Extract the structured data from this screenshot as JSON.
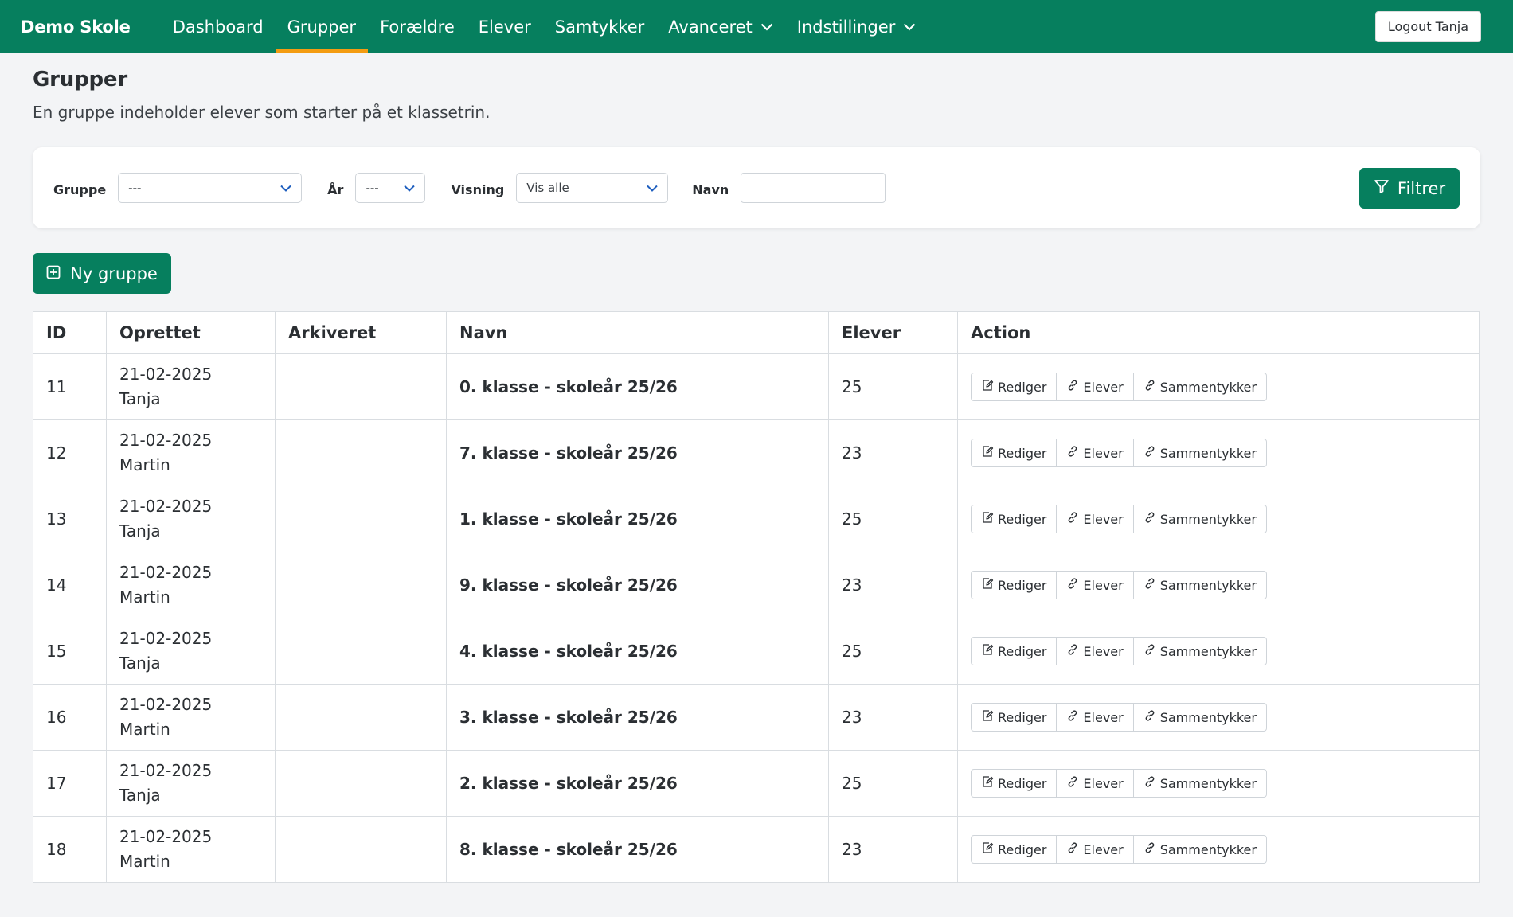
{
  "navbar": {
    "brand": "Demo Skole",
    "items": [
      {
        "label": "Dashboard",
        "active": false,
        "dropdown": false
      },
      {
        "label": "Grupper",
        "active": true,
        "dropdown": false
      },
      {
        "label": "Forældre",
        "active": false,
        "dropdown": false
      },
      {
        "label": "Elever",
        "active": false,
        "dropdown": false
      },
      {
        "label": "Samtykker",
        "active": false,
        "dropdown": false
      },
      {
        "label": "Avanceret",
        "active": false,
        "dropdown": true
      },
      {
        "label": "Indstillinger",
        "active": false,
        "dropdown": true
      }
    ],
    "logout_label": "Logout Tanja"
  },
  "page": {
    "title": "Grupper",
    "subtitle": "En gruppe indeholder elever som starter på et klassetrin."
  },
  "filters": {
    "gruppe_label": "Gruppe",
    "gruppe_value": "---",
    "aar_label": "År",
    "aar_value": "---",
    "visning_label": "Visning",
    "visning_value": "Vis alle",
    "navn_label": "Navn",
    "navn_value": "",
    "filter_button": "Filtrer"
  },
  "new_group_button": "Ny gruppe",
  "table": {
    "headers": [
      "ID",
      "Oprettet",
      "Arkiveret",
      "Navn",
      "Elever",
      "Action"
    ],
    "action_labels": {
      "edit": "Rediger",
      "students": "Elever",
      "consents": "Sammentykker"
    },
    "rows": [
      {
        "id": "11",
        "date": "21-02-2025",
        "by": "Tanja",
        "archived": "",
        "name": "0. klasse - skoleår 25/26",
        "students": "25"
      },
      {
        "id": "12",
        "date": "21-02-2025",
        "by": "Martin",
        "archived": "",
        "name": "7. klasse - skoleår 25/26",
        "students": "23"
      },
      {
        "id": "13",
        "date": "21-02-2025",
        "by": "Tanja",
        "archived": "",
        "name": "1. klasse - skoleår 25/26",
        "students": "25"
      },
      {
        "id": "14",
        "date": "21-02-2025",
        "by": "Martin",
        "archived": "",
        "name": "9. klasse - skoleår 25/26",
        "students": "23"
      },
      {
        "id": "15",
        "date": "21-02-2025",
        "by": "Tanja",
        "archived": "",
        "name": "4. klasse - skoleår 25/26",
        "students": "25"
      },
      {
        "id": "16",
        "date": "21-02-2025",
        "by": "Martin",
        "archived": "",
        "name": "3. klasse - skoleår 25/26",
        "students": "23"
      },
      {
        "id": "17",
        "date": "21-02-2025",
        "by": "Tanja",
        "archived": "",
        "name": "2. klasse - skoleår 25/26",
        "students": "25"
      },
      {
        "id": "18",
        "date": "21-02-2025",
        "by": "Martin",
        "archived": "",
        "name": "8. klasse - skoleår 25/26",
        "students": "23"
      }
    ]
  },
  "colors": {
    "primary": "#067f5e",
    "active_tab": "#f39c12",
    "background": "#f3f4f6"
  }
}
